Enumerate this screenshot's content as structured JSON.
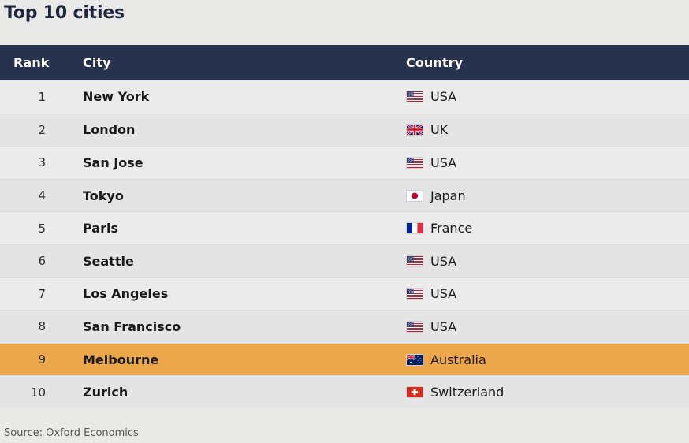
{
  "title": "Top 10 cities",
  "colors": {
    "header_bg": "#27324f",
    "header_text": "#ffffff",
    "row_odd": "#ebebeb",
    "row_even": "#e4e4e4",
    "highlight": "#eca74a",
    "page_bg": "#e9e9e7",
    "title_text": "#1f2740",
    "source_text": "#57575a"
  },
  "table": {
    "columns": [
      {
        "key": "rank",
        "label": "Rank"
      },
      {
        "key": "city",
        "label": "City"
      },
      {
        "key": "country",
        "label": "Country"
      }
    ],
    "rows": [
      {
        "rank": "1",
        "city": "New York",
        "country": "USA",
        "flag": "flag-usa",
        "highlight": false
      },
      {
        "rank": "2",
        "city": "London",
        "country": "UK",
        "flag": "flag-uk",
        "highlight": false
      },
      {
        "rank": "3",
        "city": "San Jose",
        "country": "USA",
        "flag": "flag-usa",
        "highlight": false
      },
      {
        "rank": "4",
        "city": "Tokyo",
        "country": "Japan",
        "flag": "flag-japan",
        "highlight": false
      },
      {
        "rank": "5",
        "city": "Paris",
        "country": "France",
        "flag": "flag-france",
        "highlight": false
      },
      {
        "rank": "6",
        "city": "Seattle",
        "country": "USA",
        "flag": "flag-usa",
        "highlight": false
      },
      {
        "rank": "7",
        "city": "Los Angeles",
        "country": "USA",
        "flag": "flag-usa",
        "highlight": false
      },
      {
        "rank": "8",
        "city": "San Francisco",
        "country": "USA",
        "flag": "flag-usa",
        "highlight": false
      },
      {
        "rank": "9",
        "city": "Melbourne",
        "country": "Australia",
        "flag": "flag-australia",
        "highlight": true
      },
      {
        "rank": "10",
        "city": "Zurich",
        "country": "Switzerland",
        "flag": "flag-switzerland",
        "highlight": false
      }
    ]
  },
  "source": "Source: Oxford Economics"
}
